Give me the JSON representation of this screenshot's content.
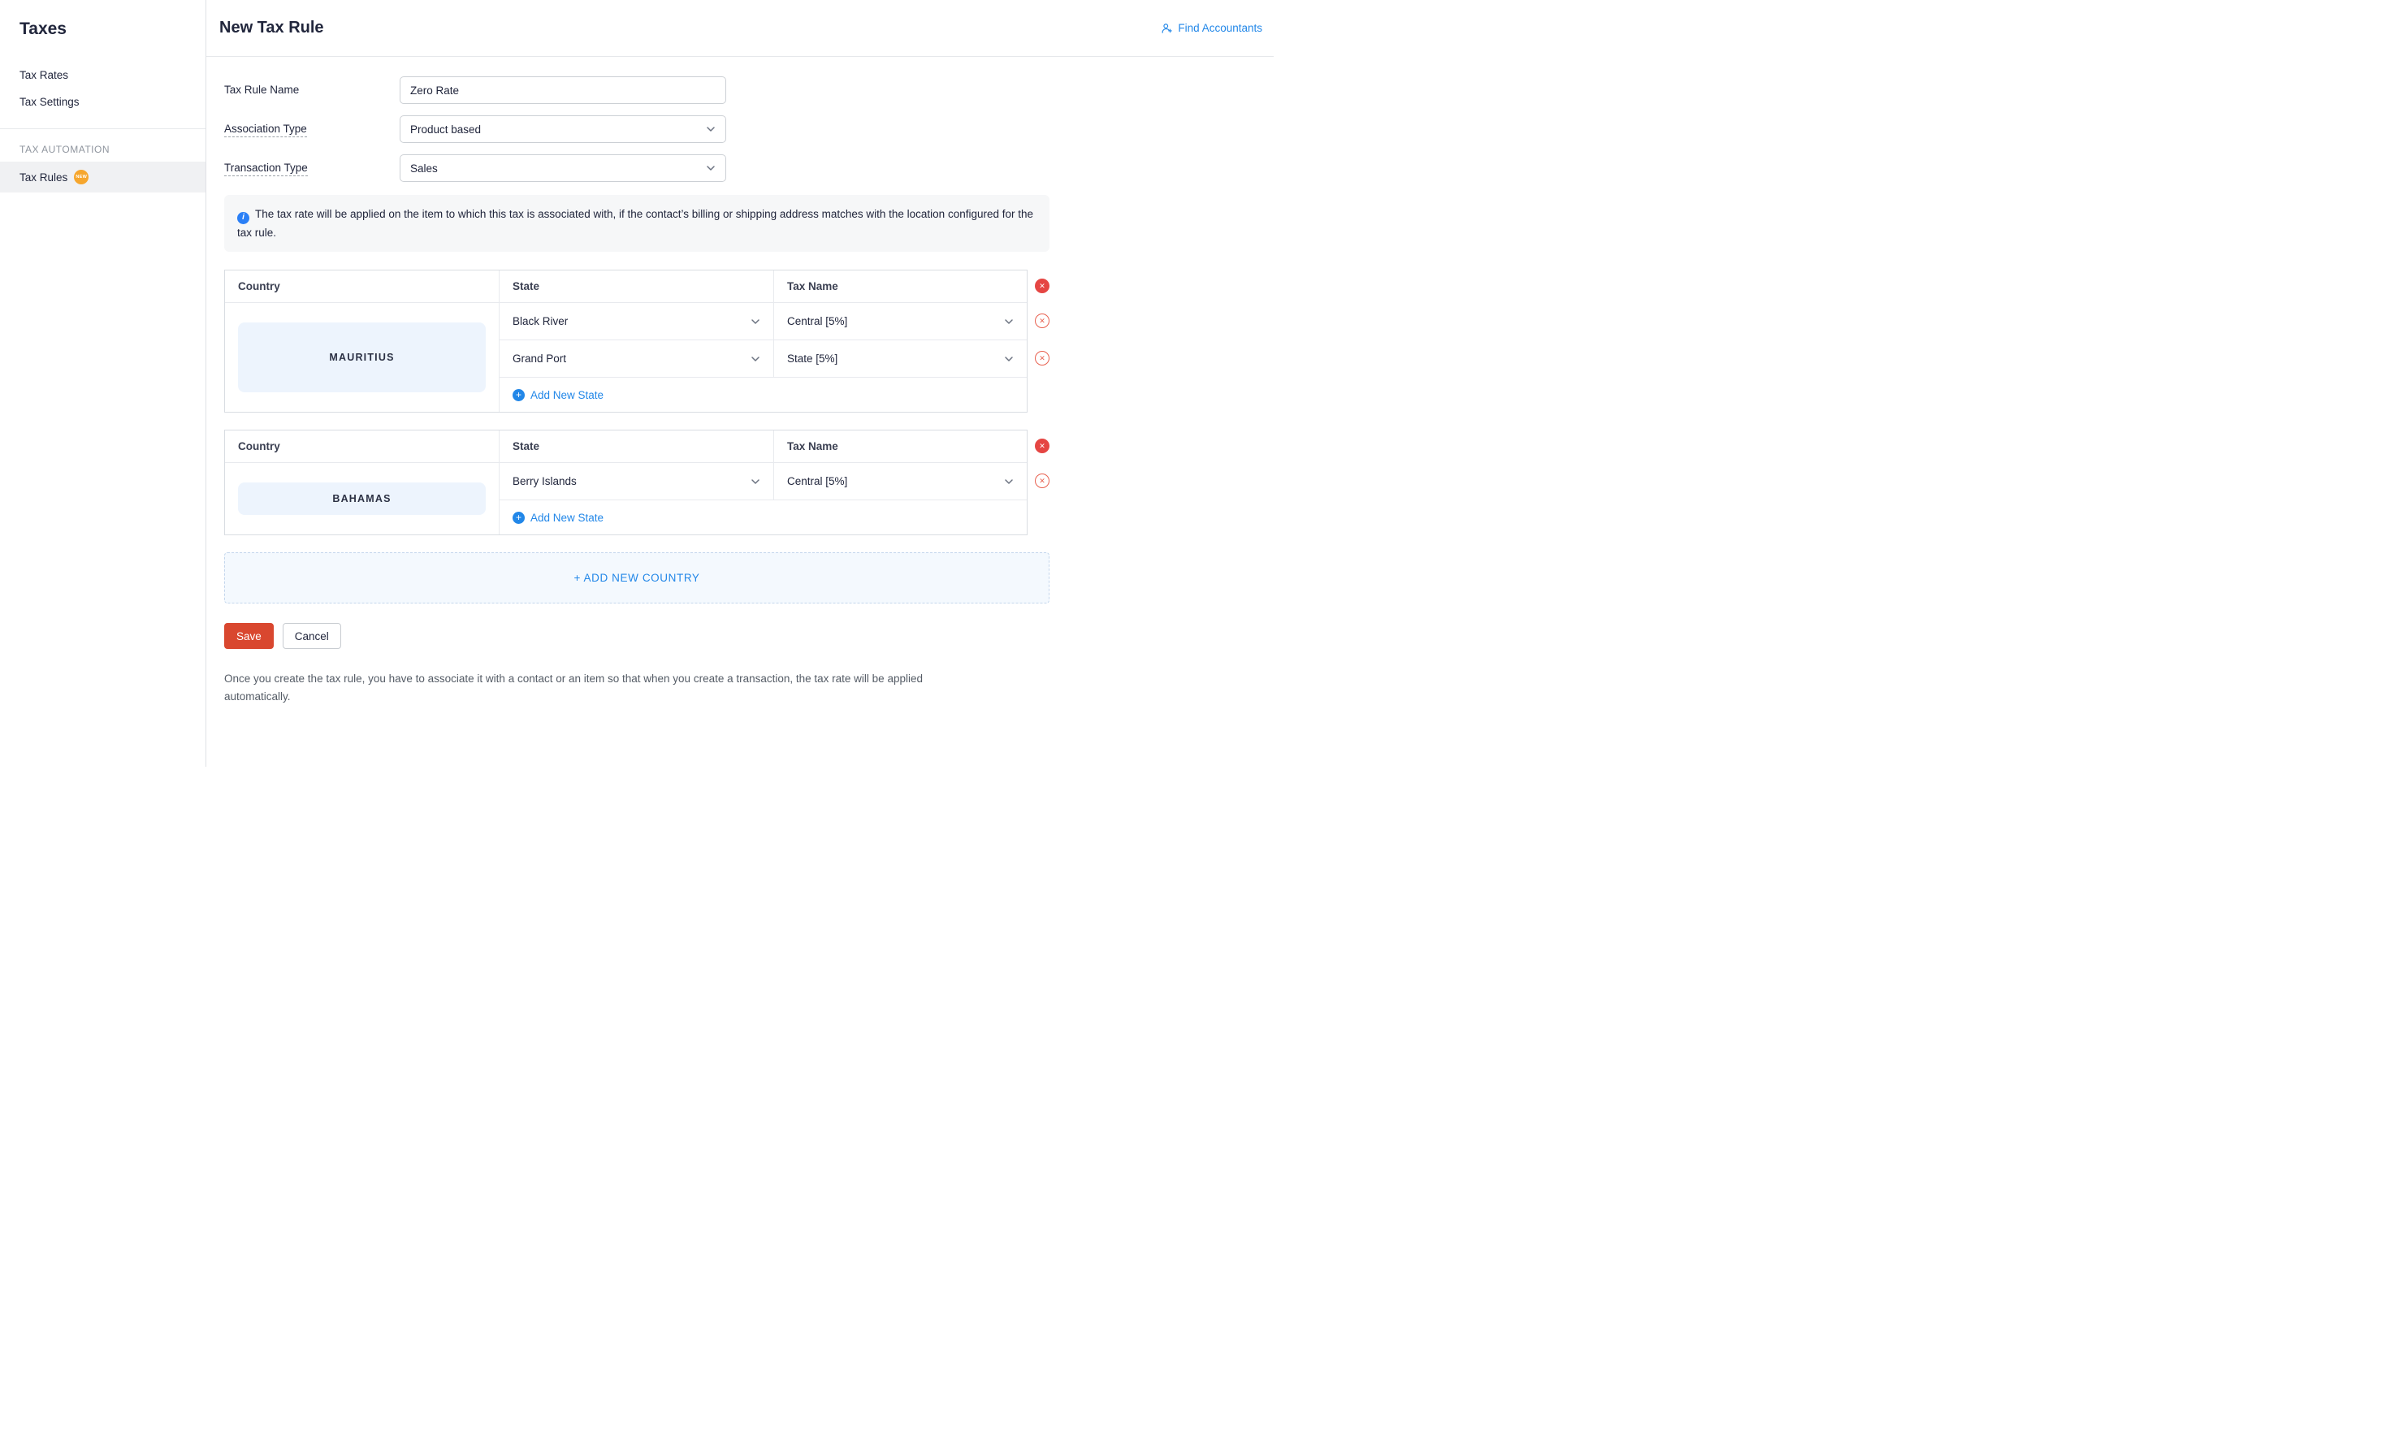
{
  "sidebar": {
    "title": "Taxes",
    "items": [
      {
        "label": "Tax Rates"
      },
      {
        "label": "Tax Settings"
      }
    ],
    "section_header": "TAX AUTOMATION",
    "active_item": {
      "label": "Tax Rules",
      "badge": "NEW"
    }
  },
  "header": {
    "title": "New Tax Rule",
    "find_accountants": "Find Accountants"
  },
  "form": {
    "tax_rule_name": {
      "label": "Tax Rule Name",
      "value": "Zero Rate"
    },
    "association_type": {
      "label": "Association Type",
      "value": "Product based"
    },
    "transaction_type": {
      "label": "Transaction Type",
      "value": "Sales"
    }
  },
  "info_note": "The tax rate will be applied on the item to which this tax is associated with, if the contact’s billing or shipping address matches with the location configured for the tax rule.",
  "table": {
    "headers": {
      "country": "Country",
      "state": "State",
      "tax_name": "Tax Name"
    },
    "add_new_state": "Add New State",
    "countries": [
      {
        "name": "MAURITIUS",
        "rows": [
          {
            "state": "Black River",
            "tax": "Central [5%]"
          },
          {
            "state": "Grand Port",
            "tax": "State [5%]"
          }
        ]
      },
      {
        "name": "BAHAMAS",
        "rows": [
          {
            "state": "Berry Islands",
            "tax": "Central [5%]"
          }
        ]
      }
    ]
  },
  "add_new_country_label": "+ ADD NEW COUNTRY",
  "actions": {
    "save": "Save",
    "cancel": "Cancel"
  },
  "footer_note": "Once you create the tax rule, you have to associate it with a contact or an item so that when you create a transaction, the tax rate will be applied automatically.",
  "colors": {
    "link_blue": "#2287e8",
    "save_red": "#d9472f",
    "delete_red": "#e54643",
    "delete_red_light": "#e8604f",
    "badge_orange": "#f6a62d",
    "country_chip_bg": "#edf4fd",
    "add_country_bg": "#f4f9fe"
  }
}
